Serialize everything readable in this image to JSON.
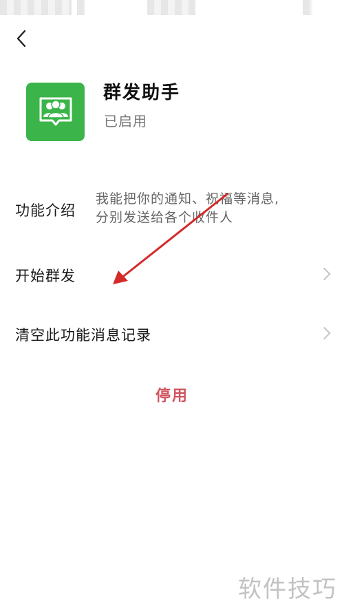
{
  "header": {
    "back_icon": "chevron-left-icon"
  },
  "app": {
    "icon": "group-users-icon",
    "icon_color": "#3bb54a",
    "title": "群发助手",
    "status": "已启用"
  },
  "intro": {
    "label": "功能介绍",
    "description_line1": "我能把你的通知、祝福等消息,",
    "description_line2": "分别发送给各个收件人"
  },
  "menu": [
    {
      "label": "开始群发",
      "icon": "chevron-right-icon"
    },
    {
      "label": "清空此功能消息记录",
      "icon": "chevron-right-icon"
    }
  ],
  "actions": {
    "disable_label": "停用",
    "disable_color": "#d0555e"
  },
  "annotation": {
    "icon": "red-arrow-icon",
    "color": "#d42a2a"
  },
  "watermark": {
    "text": "软件技巧"
  }
}
